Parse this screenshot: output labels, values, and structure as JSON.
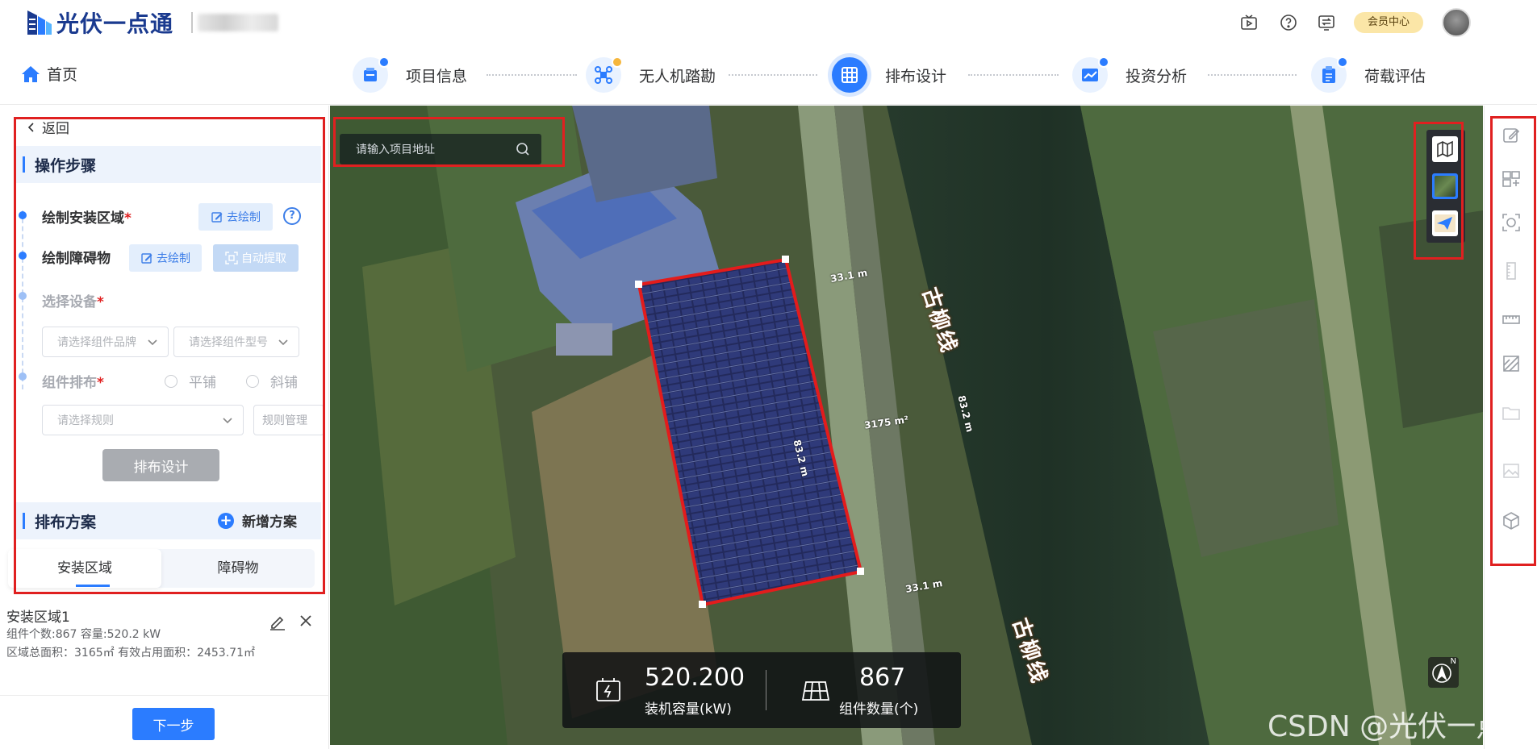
{
  "header": {
    "app_name": "光伏一点通",
    "member_button": "会员中心"
  },
  "steps": {
    "home": "首页",
    "items": [
      {
        "label": "项目信息",
        "status": "done"
      },
      {
        "label": "无人机踏勘",
        "status": "pending"
      },
      {
        "label": "排布设计",
        "status": "active"
      },
      {
        "label": "投资分析",
        "status": "done"
      },
      {
        "label": "荷载评估",
        "status": "done"
      }
    ]
  },
  "panel": {
    "back": "返回",
    "ops_title": "操作步骤",
    "draw_area_label": "绘制安装区域",
    "draw_area_btn": "去绘制",
    "draw_obstacle_label": "绘制障碍物",
    "draw_obstacle_btn": "去绘制",
    "auto_extract_btn": "自动提取",
    "select_device_label": "选择设备",
    "module_brand_placeholder": "请选择组件品牌",
    "module_model_placeholder": "请选择组件型号",
    "layout_label": "组件排布",
    "radio_flat": "平铺",
    "radio_tilt": "斜铺",
    "rule_placeholder": "请选择规则",
    "rule_manage": "规则管理",
    "layout_design_btn": "排布设计",
    "plan_title": "排布方案",
    "add_plan": "新增方案",
    "tabs": [
      "安装区域",
      "障碍物"
    ],
    "area": {
      "name": "安装区域1",
      "line1": "组件个数:867 容量:520.2 kW",
      "line2": "区域总面积：3165㎡ 有效占用面积：2453.71㎡"
    },
    "next_btn": "下一步",
    "required_mark": "*",
    "help_mark": "?"
  },
  "map": {
    "search_placeholder": "请输入项目地址",
    "road_label": "古柳线",
    "dim_top": "33.1 m",
    "dim_bottom": "33.1 m",
    "dim_left": "83.2 m",
    "dim_right": "83.2 m",
    "area_label": "3175 m²",
    "capacity_value": "520.200",
    "capacity_label": "装机容量(kW)",
    "module_count_value": "867",
    "module_count_label": "组件数量(个)",
    "compass_label": "N"
  },
  "watermark": "CSDN @光伏一点通",
  "colors": {
    "accent": "#2b7cff",
    "highlight_box": "#e02020",
    "member_bg": "#fbe6a7"
  }
}
